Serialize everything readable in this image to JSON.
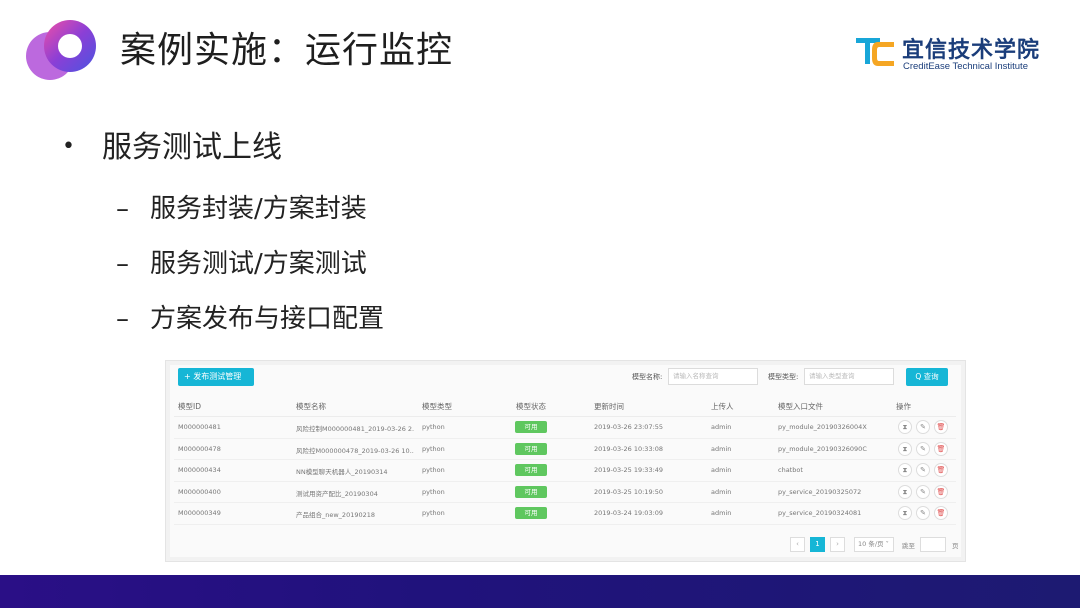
{
  "slide": {
    "title": "案例实施：运行监控",
    "brand": {
      "name_cn": "宜信技术学院",
      "name_en": "CreditEase Technical Institute",
      "colors": {
        "brand_blue": "#1a3d7a",
        "accent_orange": "#f5a623",
        "accent_cyan": "#18a6d8"
      }
    },
    "bullets": {
      "main": "服务测试上线",
      "subs": [
        "服务封装/方案封装",
        "服务测试/方案测试",
        "方案发布与接口配置"
      ]
    },
    "colors": {
      "footer": "#25127f",
      "logo_purple": "#a23fd1",
      "logo_blue": "#4a54e0"
    }
  },
  "ui": {
    "toolbar": {
      "add_button": "+ 发布测试管理",
      "filter_name_label": "模型名称:",
      "filter_name_placeholder": "请输入名称查询",
      "filter_type_label": "模型类型:",
      "filter_type_placeholder": "请输入类型查询",
      "search_button": "Q 查询"
    },
    "columns": [
      "模型ID",
      "模型名称",
      "模型类型",
      "模型状态",
      "更新时间",
      "上传人",
      "模型入口文件",
      "操作"
    ],
    "rows": [
      {
        "id": "M000000481",
        "name": "风险控制M000000481_2019-03-26 2...",
        "type": "python",
        "status": "可用",
        "updated": "2019-03-26 23:07:55",
        "uploader": "admin",
        "entry": "py_module_20190326004X"
      },
      {
        "id": "M000000478",
        "name": "风险控M000000478_2019-03-26 10...",
        "type": "python",
        "status": "可用",
        "updated": "2019-03-26 10:33:08",
        "uploader": "admin",
        "entry": "py_module_20190326090C"
      },
      {
        "id": "M000000434",
        "name": "NN模型聊天机器人_20190314",
        "type": "python",
        "status": "可用",
        "updated": "2019-03-25 19:33:49",
        "uploader": "admin",
        "entry": "chatbot"
      },
      {
        "id": "M000000400",
        "name": "测试用资产配比_20190304",
        "type": "python",
        "status": "可用",
        "updated": "2019-03-25 10:19:50",
        "uploader": "admin",
        "entry": "py_service_20190325072"
      },
      {
        "id": "M000000349",
        "name": "产品组合_new_20190218",
        "type": "python",
        "status": "可用",
        "updated": "2019-03-24 19:03:09",
        "uploader": "admin",
        "entry": "py_service_20190324081"
      }
    ],
    "actions": {
      "test": "⧗",
      "edit": "✎",
      "delete": "🗑"
    },
    "pager": {
      "prev": "‹",
      "current": "1",
      "next": "›",
      "page_size": "10 条/页 ˅",
      "goto": "跳至",
      "page_suffix": "页"
    },
    "colors": {
      "primary": "#16b6d6",
      "status_ok": "#5fc75f"
    }
  }
}
